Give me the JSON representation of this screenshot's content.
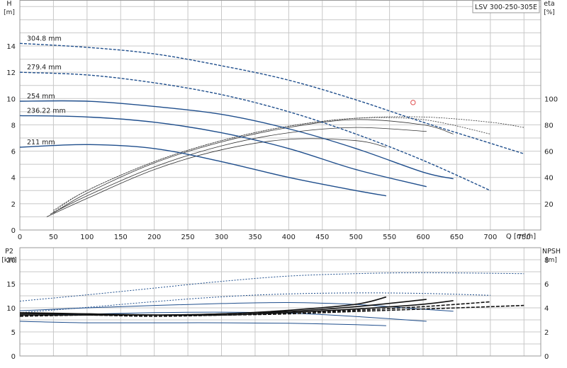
{
  "chart_data": [
    {
      "type": "line",
      "title": "LSV 300-250-305E",
      "xlabel": "Q [m³/h]",
      "ylabel_left": "H",
      "ylabel_left_unit": "[m]",
      "ylabel_right": "eta",
      "ylabel_right_unit": "[%]",
      "xlim": [
        0,
        775
      ],
      "ylim_left": [
        0,
        17.5
      ],
      "ylim_right": [
        0,
        175
      ],
      "grid": true,
      "x_ticks": [
        0,
        50,
        100,
        150,
        200,
        250,
        300,
        350,
        400,
        450,
        500,
        550,
        600,
        650,
        700,
        750
      ],
      "y_left_ticks": [
        0,
        2,
        4,
        6,
        8,
        10,
        12,
        14
      ],
      "y_right_ticks": [
        20,
        40,
        60,
        80,
        100
      ],
      "head_curves": [
        {
          "name": "304.8 mm",
          "style": "dashed",
          "color": "#1f4e8c",
          "x": [
            0,
            100,
            200,
            300,
            400,
            500,
            600,
            700,
            750
          ],
          "y": [
            14.2,
            13.9,
            13.4,
            12.5,
            11.4,
            9.9,
            8.2,
            6.6,
            5.8
          ]
        },
        {
          "name": "279.4 mm",
          "style": "dashed",
          "color": "#1f4e8c",
          "x": [
            0,
            100,
            200,
            300,
            400,
            500,
            600,
            700
          ],
          "y": [
            12.0,
            11.8,
            11.2,
            10.3,
            9.0,
            7.3,
            5.3,
            3.0
          ]
        },
        {
          "name": "254 mm",
          "style": "solid",
          "color": "#1f4e8c",
          "x": [
            0,
            100,
            200,
            300,
            400,
            500,
            600,
            645
          ],
          "y": [
            9.8,
            9.8,
            9.4,
            8.8,
            7.7,
            6.2,
            4.4,
            3.9
          ]
        },
        {
          "name": "236.22 mm",
          "style": "solid",
          "color": "#1f4e8c",
          "x": [
            0,
            100,
            200,
            300,
            400,
            500,
            605
          ],
          "y": [
            8.7,
            8.6,
            8.2,
            7.4,
            6.2,
            4.6,
            3.3
          ]
        },
        {
          "name": "211 mm",
          "style": "solid",
          "color": "#1f4e8c",
          "x": [
            0,
            100,
            200,
            300,
            400,
            500,
            545
          ],
          "y": [
            6.3,
            6.5,
            6.2,
            5.2,
            4.0,
            3.0,
            2.6
          ]
        }
      ],
      "efficiency_curves": [
        {
          "style": "dashed",
          "x": [
            50,
            100,
            200,
            300,
            400,
            500,
            600,
            700,
            750
          ],
          "y": [
            15,
            30,
            52,
            68,
            79,
            85,
            86,
            82,
            78
          ]
        },
        {
          "style": "dashed",
          "x": [
            50,
            100,
            200,
            300,
            400,
            500,
            600,
            700
          ],
          "y": [
            14,
            30,
            52,
            68,
            79,
            85,
            84,
            73
          ]
        },
        {
          "style": "solid",
          "x": [
            50,
            100,
            200,
            300,
            400,
            500,
            600,
            645
          ],
          "y": [
            13,
            28,
            51,
            67,
            78,
            84,
            80,
            73
          ]
        },
        {
          "style": "solid",
          "x": [
            45,
            100,
            200,
            300,
            400,
            500,
            605
          ],
          "y": [
            12,
            26,
            48,
            64,
            74,
            78,
            75
          ]
        },
        {
          "style": "solid",
          "x": [
            40,
            100,
            200,
            300,
            400,
            500,
            545
          ],
          "y": [
            10,
            24,
            46,
            61,
            69,
            68,
            63
          ]
        }
      ],
      "marker_point": {
        "x": 585,
        "y": 9.7
      }
    },
    {
      "type": "line",
      "ylabel_left": "P2",
      "ylabel_left_unit": "[kW]",
      "ylabel_right": "NPSH",
      "ylabel_right_unit": "[m]",
      "xlim": [
        0,
        775
      ],
      "ylim_left": [
        0,
        22.5
      ],
      "ylim_right": [
        0,
        9
      ],
      "grid": true,
      "y_left_ticks": [
        0,
        5,
        10,
        15,
        20
      ],
      "y_right_ticks": [
        0,
        2,
        4,
        6,
        8
      ],
      "power_curves": [
        {
          "style": "dashed",
          "color": "#1f4e8c",
          "x": [
            0,
            100,
            200,
            300,
            400,
            500,
            600,
            750
          ],
          "y": [
            11.4,
            12.7,
            14.1,
            15.5,
            16.6,
            17.1,
            17.3,
            17.1
          ]
        },
        {
          "style": "dashed",
          "color": "#1f4e8c",
          "x": [
            0,
            100,
            200,
            300,
            400,
            500,
            600,
            700
          ],
          "y": [
            9.0,
            10.1,
            11.3,
            12.3,
            12.9,
            13.1,
            13.0,
            12.6
          ]
        },
        {
          "style": "solid",
          "color": "#1f4e8c",
          "x": [
            0,
            100,
            200,
            300,
            400,
            500,
            600,
            645
          ],
          "y": [
            9.4,
            10.0,
            10.5,
            10.9,
            11.1,
            10.7,
            9.7,
            9.3
          ]
        },
        {
          "style": "solid",
          "color": "#1f4e8c",
          "x": [
            0,
            100,
            200,
            300,
            400,
            500,
            605
          ],
          "y": [
            8.5,
            8.7,
            9.0,
            9.1,
            8.9,
            8.2,
            7.2
          ]
        },
        {
          "style": "solid",
          "color": "#1f4e8c",
          "x": [
            0,
            100,
            200,
            300,
            400,
            500,
            545
          ],
          "y": [
            7.2,
            6.9,
            6.9,
            6.9,
            6.8,
            6.5,
            6.3
          ]
        }
      ],
      "npsh_curves": [
        {
          "style": "dashed",
          "x": [
            0,
            100,
            200,
            300,
            400,
            500,
            600,
            750
          ],
          "y": [
            3.3,
            3.4,
            3.4,
            3.4,
            3.5,
            3.7,
            3.9,
            4.2
          ]
        },
        {
          "style": "dashed",
          "x": [
            0,
            100,
            200,
            300,
            400,
            500,
            600,
            700
          ],
          "y": [
            3.4,
            3.4,
            3.3,
            3.4,
            3.6,
            3.8,
            4.1,
            4.5
          ]
        },
        {
          "style": "solid",
          "x": [
            0,
            100,
            200,
            300,
            400,
            500,
            600,
            645
          ],
          "y": [
            3.5,
            3.5,
            3.4,
            3.4,
            3.6,
            3.9,
            4.3,
            4.6
          ]
        },
        {
          "style": "solid",
          "x": [
            0,
            100,
            200,
            300,
            400,
            500,
            605
          ],
          "y": [
            3.6,
            3.5,
            3.4,
            3.5,
            3.7,
            4.1,
            4.7
          ]
        },
        {
          "style": "solid",
          "x": [
            0,
            100,
            200,
            300,
            400,
            500,
            545
          ],
          "y": [
            3.4,
            3.4,
            3.4,
            3.5,
            3.8,
            4.3,
            4.9
          ]
        }
      ]
    }
  ],
  "colors": {
    "curve": "#1f4e8c",
    "efficiency": "#333333",
    "grid": "#c8c8c8",
    "marker": "#e05050"
  }
}
